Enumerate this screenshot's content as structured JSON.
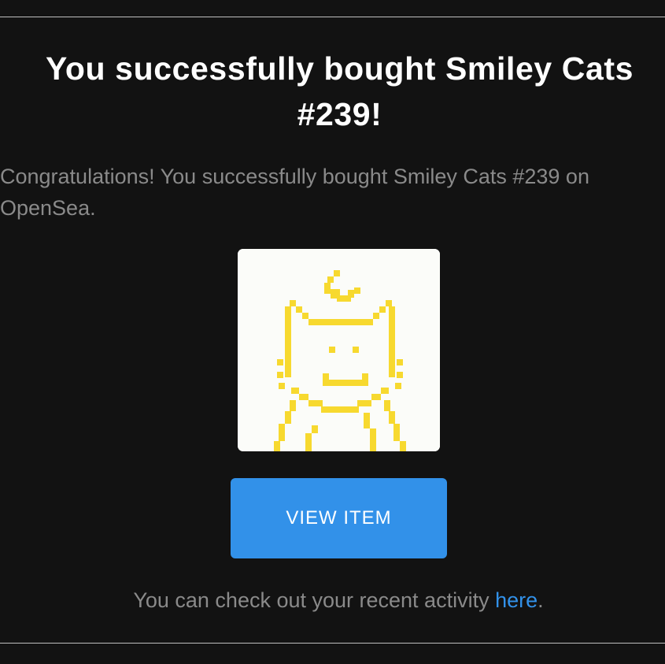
{
  "header": {
    "title": "You successfully bought Smiley Cats #239!"
  },
  "message": {
    "body": "Congratulations! You successfully bought Smiley Cats #239 on OpenSea."
  },
  "nft": {
    "background_color": "#fbfcf9",
    "pixel_color": "#f7d92f"
  },
  "actions": {
    "view_item_label": "VIEW ITEM"
  },
  "footer": {
    "text_before_link": "You can check out your recent activity ",
    "link_label": "here",
    "text_after_link": "."
  },
  "colors": {
    "background": "#121212",
    "accent": "#3291e9",
    "muted_text": "#8a8a8a",
    "title_text": "#ffffff"
  }
}
